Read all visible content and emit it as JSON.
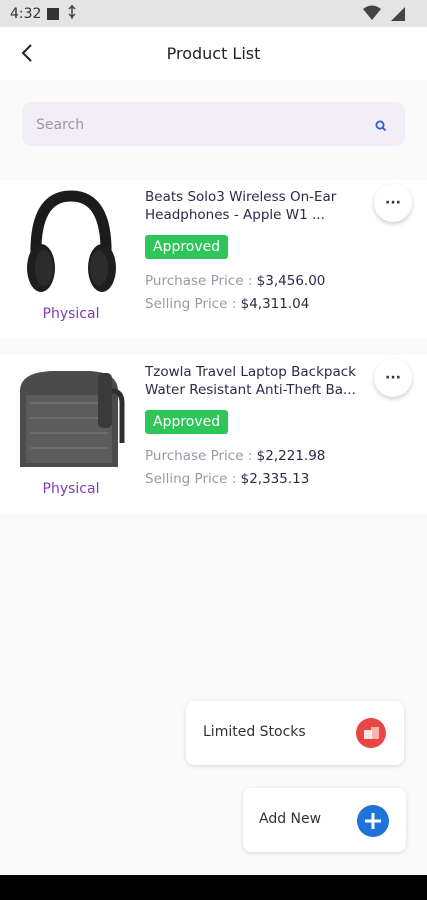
{
  "status_bar": {
    "time": "4:32"
  },
  "app_bar": {
    "title": "Product List"
  },
  "search": {
    "placeholder": "Search"
  },
  "products": [
    {
      "title": "Beats Solo3 Wireless On-Ear Headphones - Apple W1 ...",
      "badge": "Approved",
      "type": "Physical",
      "purchase_label": "Purchase Price :",
      "purchase_value": "$3,456.00",
      "selling_label": "Selling Price :",
      "selling_value": "$4,311.04"
    },
    {
      "title": "Tzowla Travel Laptop Backpack Water Resistant Anti-Theft Ba...",
      "badge": "Approved",
      "type": "Physical",
      "purchase_label": "Purchase Price :",
      "purchase_value": "$2,221.98",
      "selling_label": "Selling Price :",
      "selling_value": "$2,335.13"
    }
  ],
  "fab_menu": {
    "limited_stocks": "Limited Stocks",
    "add_new": "Add New"
  },
  "colors": {
    "accent_purple": "#7a3fb7",
    "approved_green": "#2fc659",
    "add_blue": "#1f73d8",
    "stock_red": "#e94545"
  }
}
